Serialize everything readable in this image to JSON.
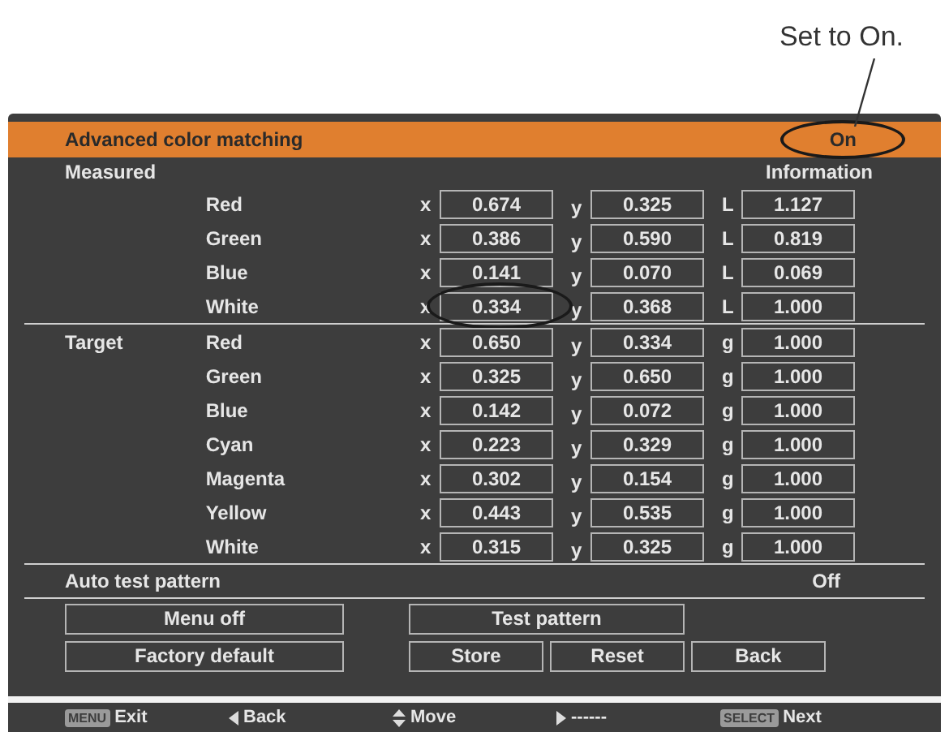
{
  "annotation": {
    "text": "Set to On."
  },
  "header": {
    "title": "Advanced color matching",
    "value": "On",
    "circled": true
  },
  "measured": {
    "label": "Measured",
    "info_label": "Information",
    "rows": [
      {
        "name": "Red",
        "cells": [
          {
            "label": "x",
            "value": "0.674",
            "circled": false
          },
          {
            "label": "y",
            "value": "0.325",
            "circled": false
          },
          {
            "label": "L",
            "value": "1.127",
            "circled": false
          }
        ]
      },
      {
        "name": "Green",
        "cells": [
          {
            "label": "x",
            "value": "0.386",
            "circled": false
          },
          {
            "label": "y",
            "value": "0.590",
            "circled": false
          },
          {
            "label": "L",
            "value": "0.819",
            "circled": false
          }
        ]
      },
      {
        "name": "Blue",
        "cells": [
          {
            "label": "x",
            "value": "0.141",
            "circled": false
          },
          {
            "label": "y",
            "value": "0.070",
            "circled": false
          },
          {
            "label": "L",
            "value": "0.069",
            "circled": false
          }
        ]
      },
      {
        "name": "White",
        "cells": [
          {
            "label": "x",
            "value": "0.334",
            "circled": true
          },
          {
            "label": "y",
            "value": "0.368",
            "circled": false
          },
          {
            "label": "L",
            "value": "1.000",
            "circled": false
          }
        ]
      }
    ]
  },
  "target": {
    "label": "Target",
    "rows": [
      {
        "name": "Red",
        "cells": [
          {
            "label": "x",
            "value": "0.650",
            "circled": false
          },
          {
            "label": "y",
            "value": "0.334",
            "circled": false
          },
          {
            "label": "g",
            "value": "1.000",
            "circled": false
          }
        ]
      },
      {
        "name": "Green",
        "cells": [
          {
            "label": "x",
            "value": "0.325",
            "circled": false
          },
          {
            "label": "y",
            "value": "0.650",
            "circled": false
          },
          {
            "label": "g",
            "value": "1.000",
            "circled": false
          }
        ]
      },
      {
        "name": "Blue",
        "cells": [
          {
            "label": "x",
            "value": "0.142",
            "circled": false
          },
          {
            "label": "y",
            "value": "0.072",
            "circled": false
          },
          {
            "label": "g",
            "value": "1.000",
            "circled": false
          }
        ]
      },
      {
        "name": "Cyan",
        "cells": [
          {
            "label": "x",
            "value": "0.223",
            "circled": false
          },
          {
            "label": "y",
            "value": "0.329",
            "circled": false
          },
          {
            "label": "g",
            "value": "1.000",
            "circled": false
          }
        ]
      },
      {
        "name": "Magenta",
        "cells": [
          {
            "label": "x",
            "value": "0.302",
            "circled": false
          },
          {
            "label": "y",
            "value": "0.154",
            "circled": false
          },
          {
            "label": "g",
            "value": "1.000",
            "circled": false
          }
        ]
      },
      {
        "name": "Yellow",
        "cells": [
          {
            "label": "x",
            "value": "0.443",
            "circled": false
          },
          {
            "label": "y",
            "value": "0.535",
            "circled": false
          },
          {
            "label": "g",
            "value": "1.000",
            "circled": false
          }
        ]
      },
      {
        "name": "White",
        "cells": [
          {
            "label": "x",
            "value": "0.315",
            "circled": false
          },
          {
            "label": "y",
            "value": "0.325",
            "circled": false
          },
          {
            "label": "g",
            "value": "1.000",
            "circled": false
          }
        ]
      }
    ]
  },
  "auto_test_pattern": {
    "label": "Auto test pattern",
    "value": "Off"
  },
  "buttons": [
    [
      "Menu off",
      "Test pattern"
    ],
    [
      "Factory default",
      "Store",
      "Reset",
      "Back"
    ]
  ],
  "footer": [
    {
      "kind": "key",
      "key": "MENU",
      "label": "Exit"
    },
    {
      "kind": "left",
      "label": "Back"
    },
    {
      "kind": "updown",
      "label": "Move"
    },
    {
      "kind": "right",
      "label": "------"
    },
    {
      "kind": "key",
      "key": "SELECT",
      "label": "Next"
    }
  ]
}
